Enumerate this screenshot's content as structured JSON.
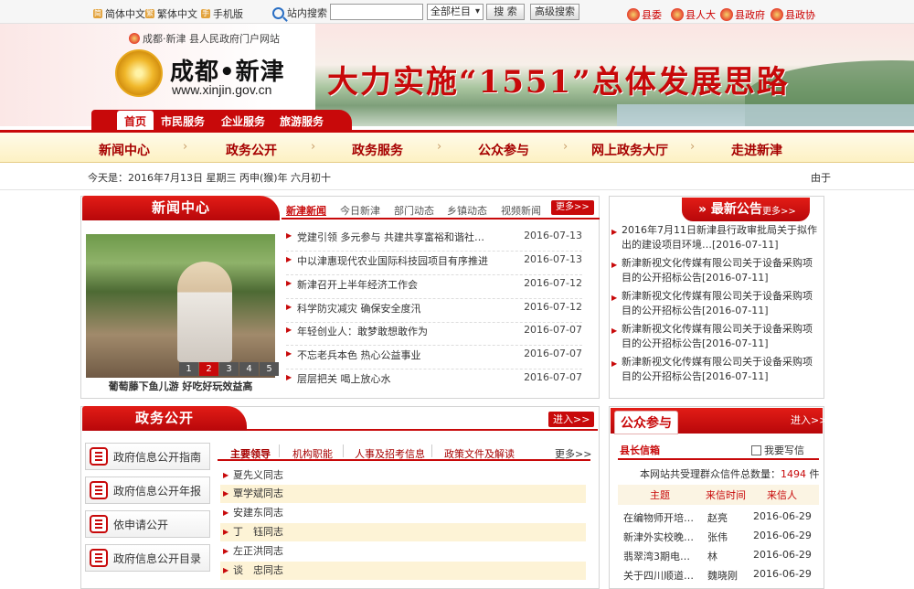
{
  "topbar": {
    "simplified": "简体中文",
    "traditional": "繁体中文",
    "mobile": "手机版",
    "search_label": "站内搜索",
    "search_value": "",
    "column_select": "全部栏目",
    "search_button": "搜 索",
    "advanced_button": "高级搜索",
    "orgs": [
      "县委",
      "县人大",
      "县政府",
      "县政协"
    ]
  },
  "banner": {
    "portal_name": "成都·新津 县人民政府门户网站",
    "logo_cn": "成都•新津",
    "logo_en": "www.xinjin.gov.cn",
    "slogan": "大力实施“1551”总体发展思路"
  },
  "subtabs": [
    "首页",
    "市民服务",
    "企业服务",
    "旅游服务"
  ],
  "mainnav": [
    "新闻中心",
    "政务公开",
    "政务服务",
    "公众参与",
    "网上政务大厅",
    "走进新津"
  ],
  "dateline": {
    "today": "今天是：2016年7月13日 星期三 丙申(猴)年 六月初十",
    "marquee": "由于"
  },
  "news": {
    "title": "新闻中心",
    "tabs": [
      "新津新闻",
      "今日新津",
      "部门动态",
      "乡镇动态",
      "视频新闻"
    ],
    "more": "更多>>",
    "photo_caption": "葡萄藤下鱼儿游 好吃好玩效益高",
    "photo_pages": [
      "1",
      "2",
      "3",
      "4",
      "5"
    ],
    "photo_current": "2",
    "items": [
      {
        "title": "党建引领 多元参与 共建共享富裕和谐社…",
        "date": "2016-07-13"
      },
      {
        "title": "中以津惠现代农业国际科技园项目有序推进",
        "date": "2016-07-13"
      },
      {
        "title": "新津召开上半年经济工作会",
        "date": "2016-07-12"
      },
      {
        "title": "科学防灾减灾 确保安全度汛",
        "date": "2016-07-12"
      },
      {
        "title": "年轻创业人：敢梦敢想敢作为",
        "date": "2016-07-07"
      },
      {
        "title": "不忘老兵本色 热心公益事业",
        "date": "2016-07-07"
      },
      {
        "title": "层层把关 喝上放心水",
        "date": "2016-07-07"
      }
    ]
  },
  "announcements": {
    "title": "» 最新公告",
    "more": "更多>>",
    "items": [
      "2016年7月11日新津县行政审批局关于拟作出的建设项目环境…[2016-07-11]",
      "新津新视文化传媒有限公司关于设备采购项目的公开招标公告[2016-07-11]",
      "新津新视文化传媒有限公司关于设备采购项目的公开招标公告[2016-07-11]",
      "新津新视文化传媒有限公司关于设备采购项目的公开招标公告[2016-07-11]",
      "新津新视文化传媒有限公司关于设备采购项目的公开招标公告[2016-07-11]"
    ]
  },
  "gov": {
    "title": "政务公开",
    "enter": "进入>>",
    "buttons": [
      "政府信息公开指南",
      "政府信息公开年报",
      "依申请公开",
      "政府信息公开目录"
    ],
    "tabs": [
      "主要领导",
      "机构职能",
      "人事及招考信息",
      "政策文件及解读"
    ],
    "more": "更多>>",
    "leaders": [
      "夏先义同志",
      "覃学斌同志",
      "安建东同志",
      "丁　钰同志",
      "左正洪同志",
      "谈　忠同志"
    ]
  },
  "public": {
    "title": "公众参与",
    "enter": "进入>>",
    "tab": "县长信箱",
    "write": "我要写信",
    "count_label": "本网站共受理群众信件总数量：",
    "count_value": "1494",
    "count_unit": "件",
    "headers": [
      "主题",
      "来信时间",
      "来信人"
    ],
    "rows": [
      {
        "subject": "在编物师开培…",
        "sender": "赵亮",
        "date": "2016-06-29"
      },
      {
        "subject": "新津外实校晚…",
        "sender": "张伟",
        "date": "2016-06-29"
      },
      {
        "subject": "翡翠湾3期电…",
        "sender": "林",
        "date": "2016-06-29"
      },
      {
        "subject": "关于四川顺道…",
        "sender": "魏晓刚",
        "date": "2016-06-29"
      }
    ]
  }
}
